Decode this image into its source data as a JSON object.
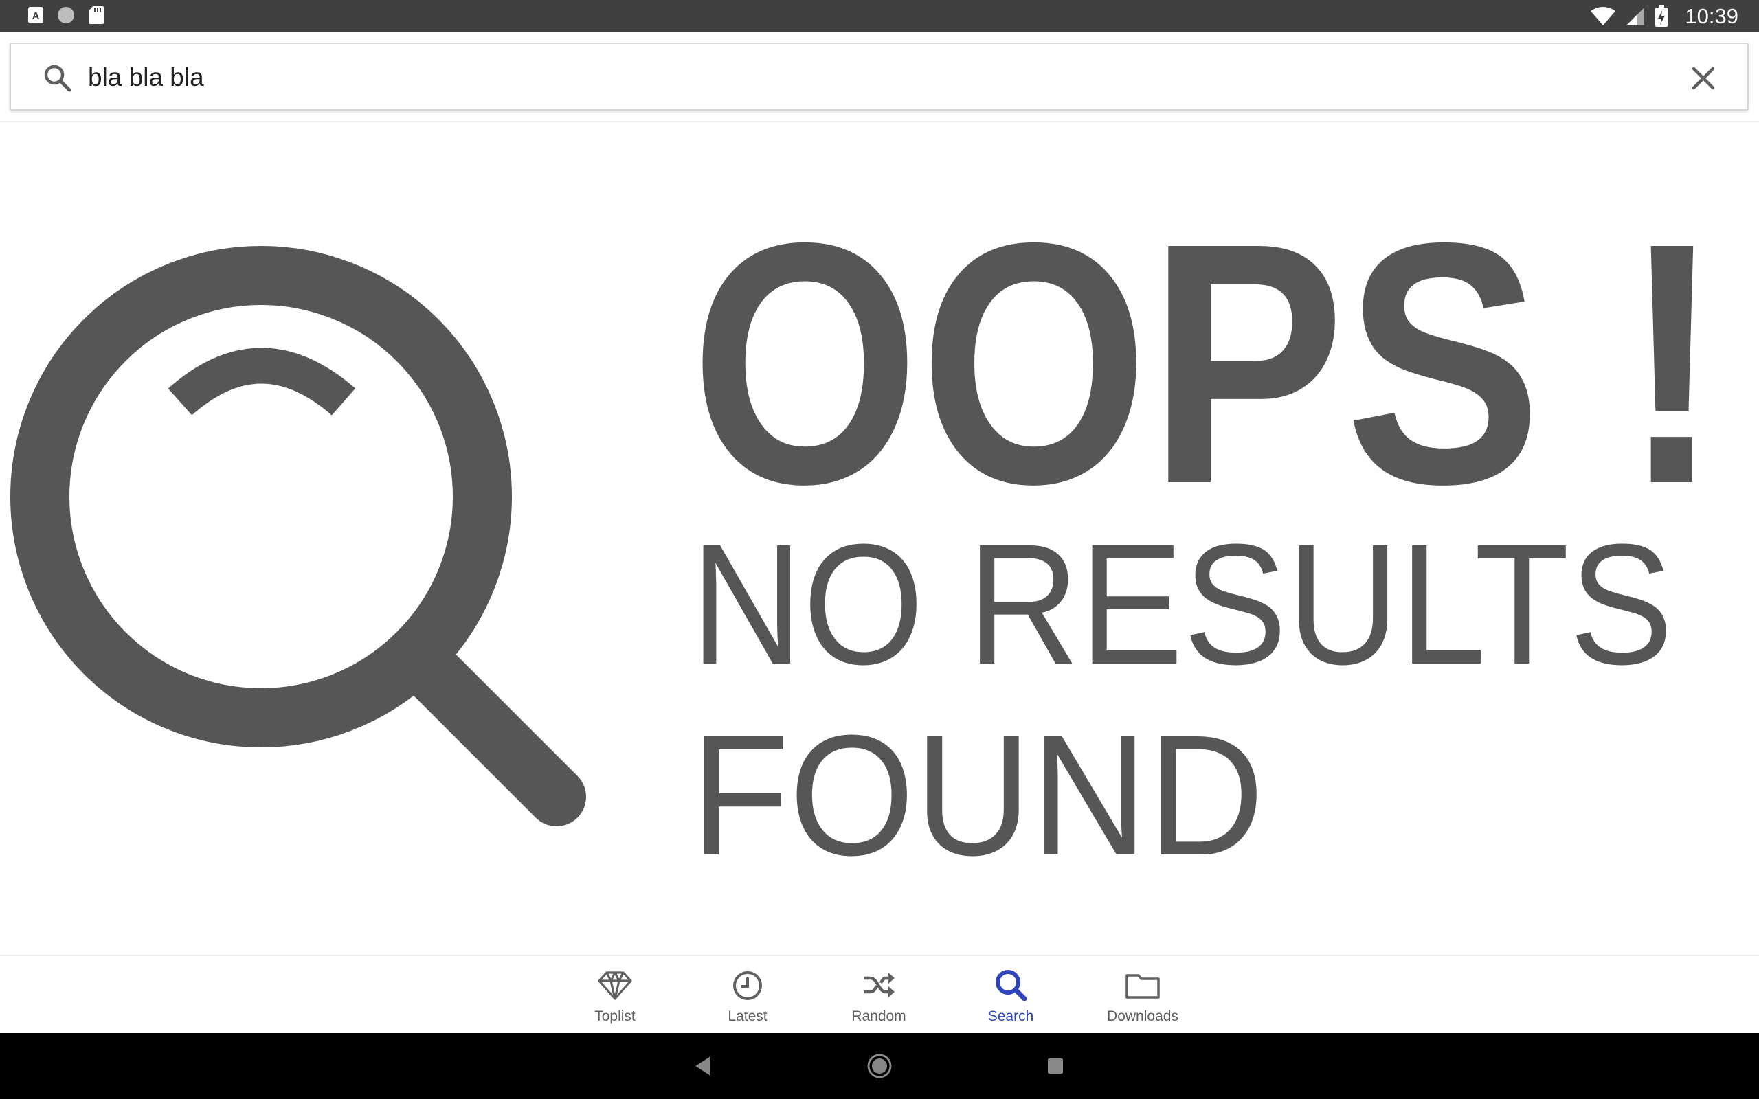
{
  "status_bar": {
    "time": "10:39",
    "left_icons": [
      "keyboard-a-icon",
      "circle-icon",
      "sd-card-icon"
    ],
    "right_icons": [
      "wifi-icon",
      "cell-signal-icon",
      "battery-charging-icon"
    ]
  },
  "search": {
    "query": "bla bla bla",
    "icon": "search-icon",
    "clear_icon": "close-icon"
  },
  "empty_state": {
    "line1": "OOPS !",
    "line2": "NO RESULTS",
    "line3": "FOUND",
    "color": "#565656"
  },
  "bottom_nav": {
    "items": [
      {
        "label": "Toplist",
        "icon": "diamond-icon",
        "active": false
      },
      {
        "label": "Latest",
        "icon": "clock-icon",
        "active": false
      },
      {
        "label": "Random",
        "icon": "shuffle-icon",
        "active": false
      },
      {
        "label": "Search",
        "icon": "search-icon",
        "active": true
      },
      {
        "label": "Downloads",
        "icon": "folder-icon",
        "active": false
      }
    ],
    "active_color": "#2f45b9",
    "inactive_color": "#606060"
  },
  "system_nav": [
    "back-icon",
    "home-icon",
    "recents-icon"
  ]
}
